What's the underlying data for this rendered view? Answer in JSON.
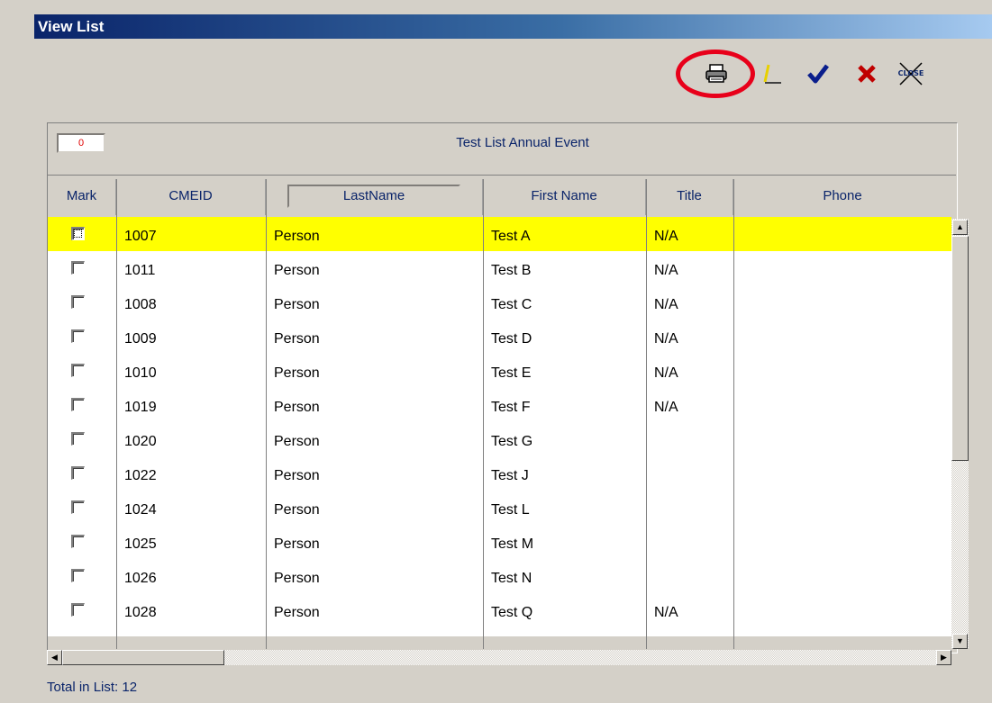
{
  "window": {
    "title": "View List"
  },
  "toolbar": {
    "icons": [
      "printer-icon",
      "pencil-edit-icon",
      "checkmark-icon",
      "x-delete-icon",
      "close-icon"
    ],
    "close_label": "CLOSE",
    "highlight_color": "#e8001a"
  },
  "list": {
    "count": "0",
    "title": "Test List Annual Event",
    "columns": [
      "Mark",
      "CMEID",
      "LastName",
      "First Name",
      "Title",
      "Phone"
    ],
    "rows": [
      {
        "cmeid": "1007",
        "last": "Person",
        "first": "Test A",
        "title": "N/A",
        "phone": ""
      },
      {
        "cmeid": "1011",
        "last": "Person",
        "first": "Test B",
        "title": "N/A",
        "phone": ""
      },
      {
        "cmeid": "1008",
        "last": "Person",
        "first": "Test C",
        "title": "N/A",
        "phone": ""
      },
      {
        "cmeid": "1009",
        "last": "Person",
        "first": "Test D",
        "title": "N/A",
        "phone": ""
      },
      {
        "cmeid": "1010",
        "last": "Person",
        "first": "Test E",
        "title": "N/A",
        "phone": ""
      },
      {
        "cmeid": "1019",
        "last": "Person",
        "first": "Test F",
        "title": "N/A",
        "phone": ""
      },
      {
        "cmeid": "1020",
        "last": "Person",
        "first": "Test G",
        "title": "",
        "phone": ""
      },
      {
        "cmeid": "1022",
        "last": "Person",
        "first": "Test J",
        "title": "",
        "phone": ""
      },
      {
        "cmeid": "1024",
        "last": "Person",
        "first": "Test L",
        "title": "",
        "phone": ""
      },
      {
        "cmeid": "1025",
        "last": "Person",
        "first": "Test M",
        "title": "",
        "phone": ""
      },
      {
        "cmeid": "1026",
        "last": "Person",
        "first": "Test N",
        "title": "",
        "phone": ""
      },
      {
        "cmeid": "1028",
        "last": "Person",
        "first": "Test Q",
        "title": "N/A",
        "phone": ""
      }
    ],
    "selected_row_color": "#ffff00"
  },
  "footer": {
    "total_label": "Total in List: 12"
  }
}
